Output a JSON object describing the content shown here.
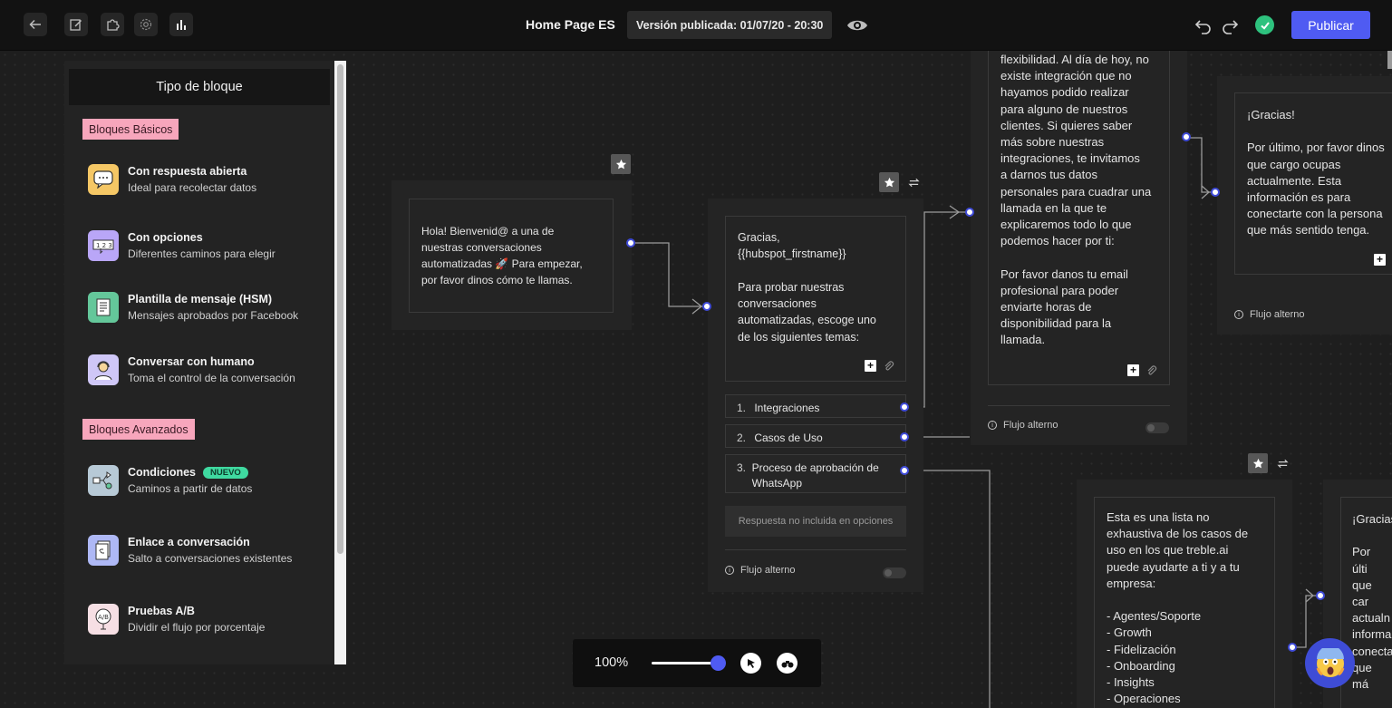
{
  "header": {
    "page_title": "Home Page ES",
    "version_label": "Versión publicada:",
    "version_value": "01/07/20 - 20:30",
    "publish_label": "Publicar"
  },
  "panel": {
    "title": "Tipo de bloque",
    "basic_section": "Bloques Básicos",
    "advanced_section": "Bloques Avanzados",
    "basic_blocks": [
      {
        "title": "Con respuesta abierta",
        "desc": "Ideal para recolectar datos",
        "icon": "chat-bubble-icon",
        "color": "#f5c765"
      },
      {
        "title": "Con opciones",
        "desc": "Diferentes caminos para elegir",
        "icon": "options-icon",
        "color": "#b9a6f7"
      },
      {
        "title": "Plantilla de mensaje (HSM)",
        "desc": "Mensajes aprobados por Facebook",
        "icon": "template-icon",
        "color": "#64c79a"
      },
      {
        "title": "Conversar con humano",
        "desc": "Toma el control de la conversación",
        "icon": "human-agent-icon",
        "color": "#cfc7f7"
      }
    ],
    "advanced_blocks": [
      {
        "title": "Condiciones",
        "badge": "NUEVO",
        "desc": "Caminos a partir de datos",
        "icon": "conditions-icon",
        "color": "#b7c9d6"
      },
      {
        "title": "Enlace a conversación",
        "desc": "Salto a conversaciones existentes",
        "icon": "link-conversation-icon",
        "color": "#aeb8f5"
      },
      {
        "title": "Pruebas A/B",
        "desc": "Dividir el flujo por porcentaje",
        "icon": "ab-test-icon",
        "color": "#f6dfe4"
      }
    ]
  },
  "nodes": {
    "welcome": {
      "text": "Hola! Bienvenid@ a una de\nnuestras conversaciones\nautomatizadas 🚀 Para empezar,\npor favor dinos cómo te llamas."
    },
    "options_node": {
      "text": "Gracias,\n{{hubspot_firstname}}\n\nPara probar nuestras\nconversaciones\nautomatizadas, escoge uno\nde los siguientes temas:",
      "options": [
        {
          "num": "1.",
          "label": "Integraciones"
        },
        {
          "num": "2.",
          "label": "Casos de Uso"
        },
        {
          "num": "3.",
          "label": "Proceso de aprobación de WhatsApp"
        }
      ],
      "no_response": "Respuesta no incluida en opciones",
      "alt_flow": "Flujo alterno"
    },
    "integrations_node": {
      "text": "flexibilidad. Al día de hoy, no\nexiste integración que no\nhayamos podido realizar\npara alguno de nuestros\nclientes. Si quieres saber\nmás sobre nuestras\nintegraciones, te invitamos\na darnos tus datos\npersonales para cuadrar una\nllamada en la que te\nexplicaremos todo lo que\npodemos hacer por ti:\n\nPor favor danos tu email\nprofesional para poder\nenviarte horas de\ndisponibilidad para la\nllamada.",
      "alt_flow": "Flujo alterno"
    },
    "thanks_node": {
      "text": "¡Gracias!\n\nPor último, por favor dinos\nque cargo ocupas\nactualmente. Esta\ninformación es para\nconectarte con la persona\nque más sentido tenga.",
      "alt_flow": "Flujo alterno"
    },
    "use_cases_node": {
      "text": "Esta es una lista no\nexhaustiva de los casos de\nuso en los que treble.ai\npuede ayudarte a ti y a tu\nempresa:\n\n- Agentes/Soporte\n- Growth\n- Fidelización\n- Onboarding\n- Insights\n- Operaciones"
    },
    "thanks_node_2": {
      "text": "¡Gracias\n\nPor últi\nque car\nactualn\ninforma\nconecta\nque má"
    }
  },
  "zoom": {
    "label": "100%",
    "level_percent": 100
  },
  "colors": {
    "accent": "#4f5bf2",
    "success": "#2ec27e",
    "tag_pink": "#f7a6bc",
    "badge_green": "#3fd9a0"
  }
}
